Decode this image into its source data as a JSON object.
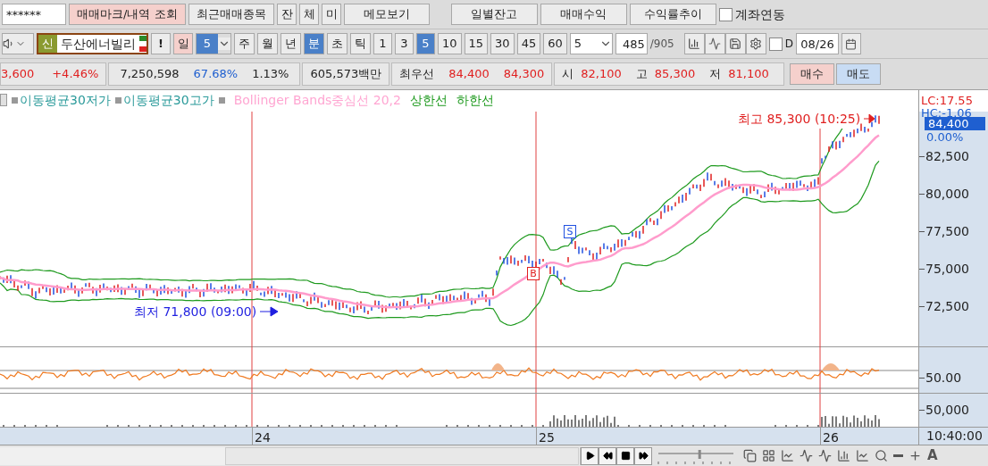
{
  "top_bar": {
    "account_field": {
      "value": "******"
    },
    "buttons": [
      {
        "label": "매매마크/내역 조회",
        "highlighted": true
      },
      {
        "label": "최근매매종목",
        "highlighted": false
      }
    ],
    "small_buttons": [
      "잔",
      "체",
      "미"
    ],
    "memo_button": "메모보기",
    "right_buttons": [
      "일별잔고",
      "매매수익",
      "수익률추이"
    ],
    "account_link": {
      "label": "계좌연동",
      "checked": false
    }
  },
  "toolbar": {
    "credit_badge": "신",
    "stock_name": "두산에너빌리",
    "alert_button": "!",
    "day_button": {
      "label": "일",
      "highlighted": true
    },
    "day_count": "5",
    "unit_tabs": [
      {
        "label": "주",
        "selected": false
      },
      {
        "label": "월",
        "selected": false
      },
      {
        "label": "년",
        "selected": false
      },
      {
        "label": "분",
        "selected": true
      },
      {
        "label": "초",
        "selected": false
      },
      {
        "label": "틱",
        "selected": false
      }
    ],
    "interval_tabs": [
      {
        "label": "1",
        "selected": false
      },
      {
        "label": "3",
        "selected": false
      },
      {
        "label": "5",
        "selected": true
      },
      {
        "label": "10",
        "selected": false
      },
      {
        "label": "15",
        "selected": false
      },
      {
        "label": "30",
        "selected": false
      },
      {
        "label": "45",
        "selected": false
      },
      {
        "label": "60",
        "selected": false
      }
    ],
    "interval_select": "5",
    "count_field": "485",
    "count_total": "/905",
    "d_checkbox": {
      "label": "D",
      "checked": false
    },
    "date_field": "08/26"
  },
  "quote": {
    "change": "3,600",
    "change_rate": "+4.46%",
    "volume": "7,250,598",
    "volume_ratio": "67.68%",
    "turnover": "1.13%",
    "amount": "605,573백만",
    "best_label": "최우선",
    "best_ask": "84,400",
    "best_bid": "84,300",
    "ohl": [
      {
        "label": "시",
        "value": "82,100"
      },
      {
        "label": "고",
        "value": "85,300"
      },
      {
        "label": "저",
        "value": "81,100"
      }
    ],
    "buy_button": "매수",
    "sell_button": "매도"
  },
  "chart": {
    "legend": [
      {
        "label": "이동평균30저가",
        "color": "#2a9a9a"
      },
      {
        "label": "이동평균30고가",
        "color": "#2a9a9a"
      },
      {
        "label": "Bollinger Bands중심선 20,2",
        "color": "#ffa6d2"
      },
      {
        "label": "상한선",
        "color": "#1e9a1e"
      },
      {
        "label": "하한선",
        "color": "#1e9a1e"
      }
    ],
    "high_note": "최고 85,300 (10:25)",
    "low_note": "최저 71,800 (09:00)",
    "buy_mark": "B",
    "sell_mark": "S",
    "axis": {
      "lc": "LC:17.55",
      "hc": "HC:-1.06",
      "current": "84,400",
      "current_rate": "0.00%",
      "ticks": [
        "82,500",
        "80,000",
        "77,500",
        "75,000",
        "72,500"
      ],
      "indicator_tick": "50.00",
      "volume_tick": "50,000",
      "time": "10:40:00"
    },
    "days": [
      "24",
      "25",
      "26"
    ]
  },
  "bottom_bar": {
    "speed_slider": {
      "level": 0.55
    },
    "font_button": "A"
  }
}
